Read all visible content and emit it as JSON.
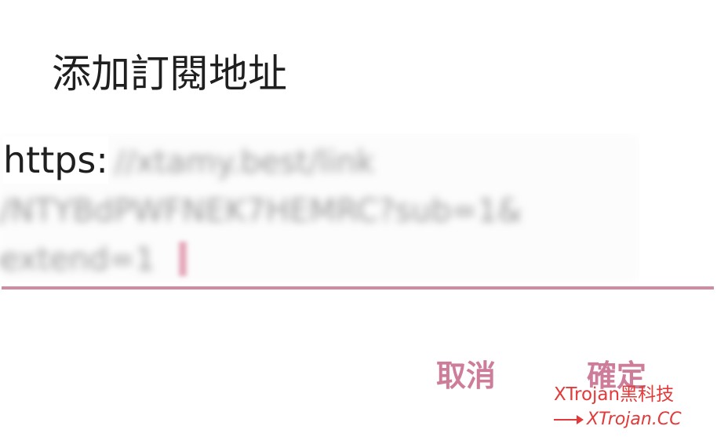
{
  "dialog": {
    "title": "添加訂閱地址",
    "url_field": {
      "prefix": "https:",
      "rest_line1": "//xtamy.best/link",
      "rest_line2": "/NTYBdPWFNEK7HEMRC?sub=1&",
      "rest_line3": "extend=1"
    },
    "cancel_label": "取消",
    "ok_label": "確定"
  },
  "watermark": {
    "line1": "XTrojan黑科技",
    "line2": "XTrojan.CC"
  },
  "colors": {
    "accent": "#d08aa1",
    "button_text": "#cd7d99",
    "watermark": "#e23a3a"
  }
}
